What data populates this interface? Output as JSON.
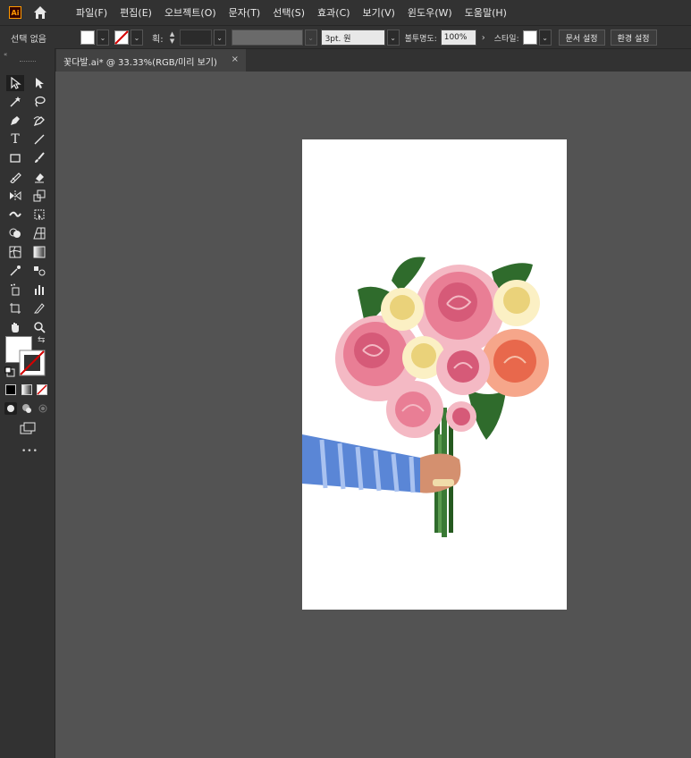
{
  "app": {
    "logo_text": "Ai"
  },
  "menubar": {
    "items": [
      "파일(F)",
      "편집(E)",
      "오브젝트(O)",
      "문자(T)",
      "선택(S)",
      "효과(C)",
      "보기(V)",
      "윈도우(W)",
      "도움말(H)"
    ]
  },
  "control_bar": {
    "selection_label": "선택 없음",
    "stroke_label": "획:",
    "brush_value": "3pt. 원",
    "opacity_label": "불투명도:",
    "opacity_value": "100%",
    "style_label": "스타일:",
    "doc_setup_button": "문서 설정",
    "preferences_button": "환경 설정"
  },
  "document_tab": {
    "title": "꽃다발.ai* @ 33.33%(RGB/미리 보기)",
    "close": "×"
  },
  "toolbar": {
    "more": "•••"
  },
  "colors": {
    "ui_dark": "#323232",
    "canvas": "#535353",
    "artboard": "#ffffff",
    "accent_orange": "#ff9a00"
  }
}
